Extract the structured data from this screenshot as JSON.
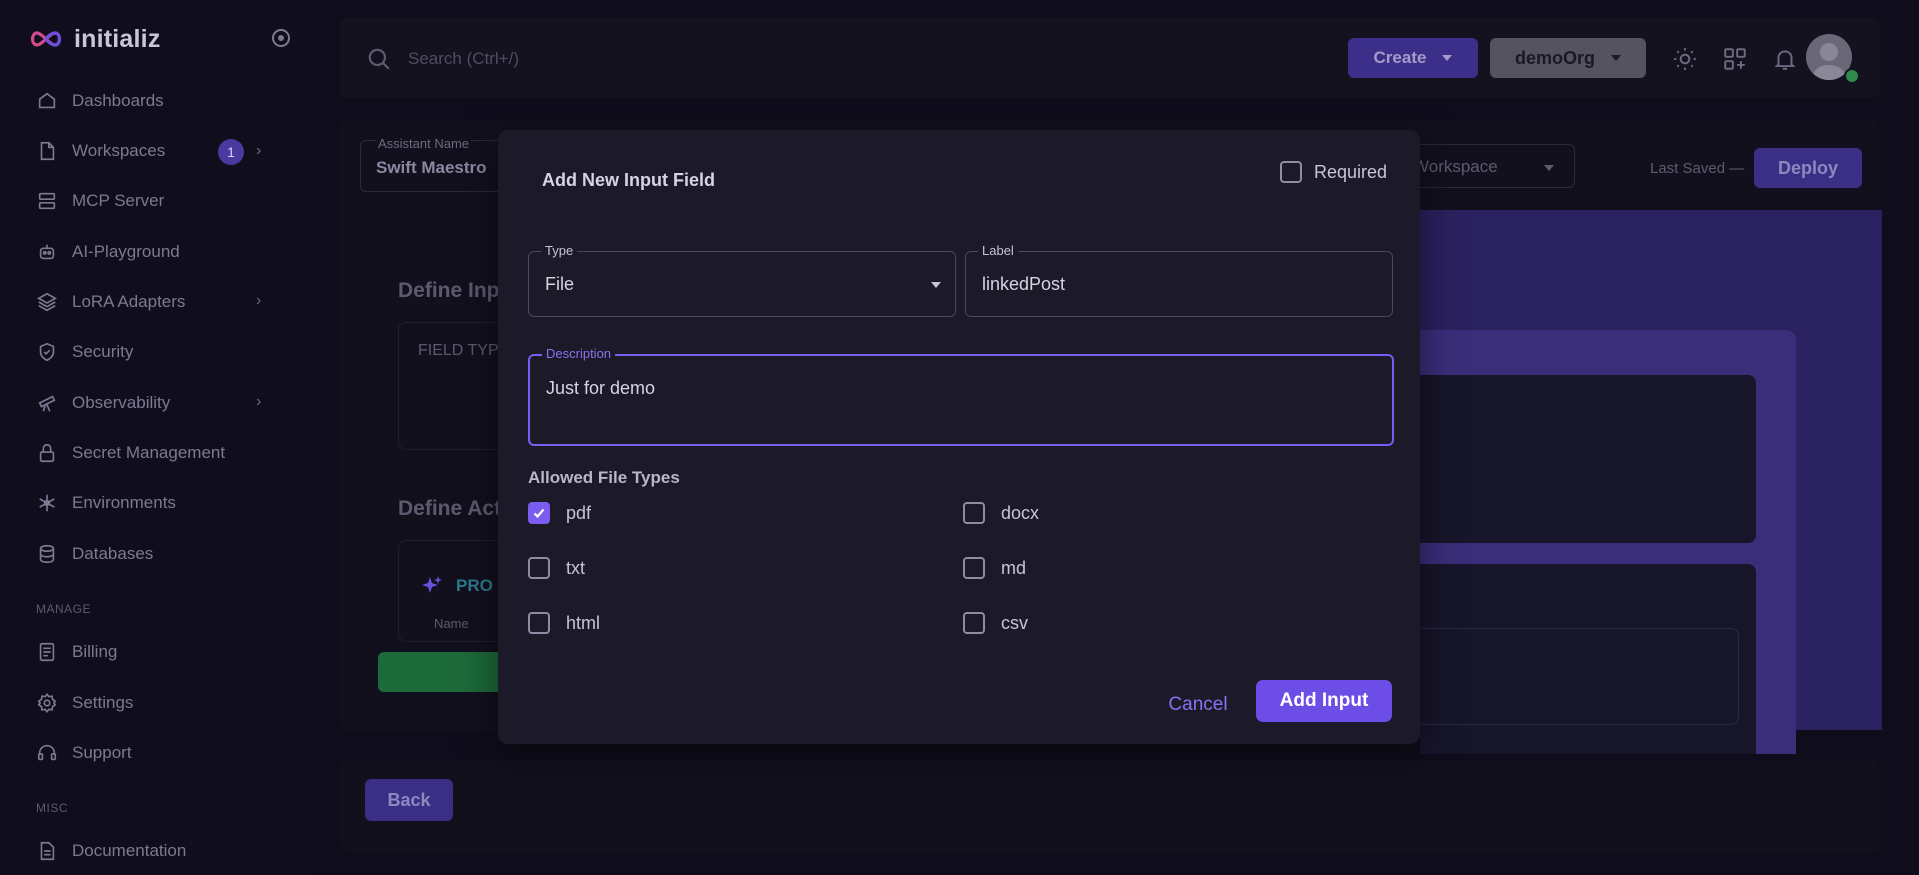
{
  "sidebar": {
    "brand": "initializ",
    "items": [
      {
        "label": "Dashboards",
        "icon": "home-icon"
      },
      {
        "label": "Workspaces",
        "icon": "file-icon",
        "badge": "1"
      },
      {
        "label": "MCP Server",
        "icon": "server-icon"
      },
      {
        "label": "AI-Playground",
        "icon": "robot-icon"
      },
      {
        "label": "LoRA Adapters",
        "icon": "layers-icon"
      },
      {
        "label": "Security",
        "icon": "shield-icon"
      },
      {
        "label": "Observability",
        "icon": "telescope-icon"
      },
      {
        "label": "Secret Management",
        "icon": "lock-icon"
      },
      {
        "label": "Environments",
        "icon": "snowflake-icon"
      },
      {
        "label": "Databases",
        "icon": "database-icon"
      }
    ],
    "manage_section": "MANAGE",
    "manage_items": [
      {
        "label": "Billing",
        "icon": "receipt-icon"
      },
      {
        "label": "Settings",
        "icon": "gear-icon"
      },
      {
        "label": "Support",
        "icon": "headset-icon"
      }
    ],
    "misc_section": "MISC",
    "misc_items": [
      {
        "label": "Documentation",
        "icon": "document-icon"
      }
    ]
  },
  "topbar": {
    "search_placeholder": "Search (Ctrl+/)",
    "create_label": "Create",
    "org_label": "demoOrg"
  },
  "editor": {
    "assistant_name_label": "Assistant Name",
    "assistant_name_value": "Swift Maestro",
    "workspace_placeholder": "Workspace",
    "last_saved": "Last Saved —",
    "deploy_label": "Deploy",
    "define_inputs_title": "Define Inp",
    "field_type_header": "FIELD TYP",
    "define_actions_title": "Define Act",
    "prompt_label": "PRO",
    "name_label": "Name",
    "back_label": "Back"
  },
  "modal": {
    "title": "Add New Input Field",
    "required_label": "Required",
    "required_checked": false,
    "type_label": "Type",
    "type_value": "File",
    "label_label": "Label",
    "label_value": "linkedPost",
    "description_label": "Description",
    "description_value": "Just for demo",
    "allowed_file_types_title": "Allowed File Types",
    "file_types": [
      {
        "label": "pdf",
        "checked": true
      },
      {
        "label": "docx",
        "checked": false
      },
      {
        "label": "txt",
        "checked": false
      },
      {
        "label": "md",
        "checked": false
      },
      {
        "label": "html",
        "checked": false
      },
      {
        "label": "csv",
        "checked": false
      }
    ],
    "cancel_label": "Cancel",
    "add_label": "Add Input"
  },
  "colors": {
    "accent": "#7b5cf0",
    "background": "#0f0d1b",
    "modal_bg": "#1c1a28"
  }
}
